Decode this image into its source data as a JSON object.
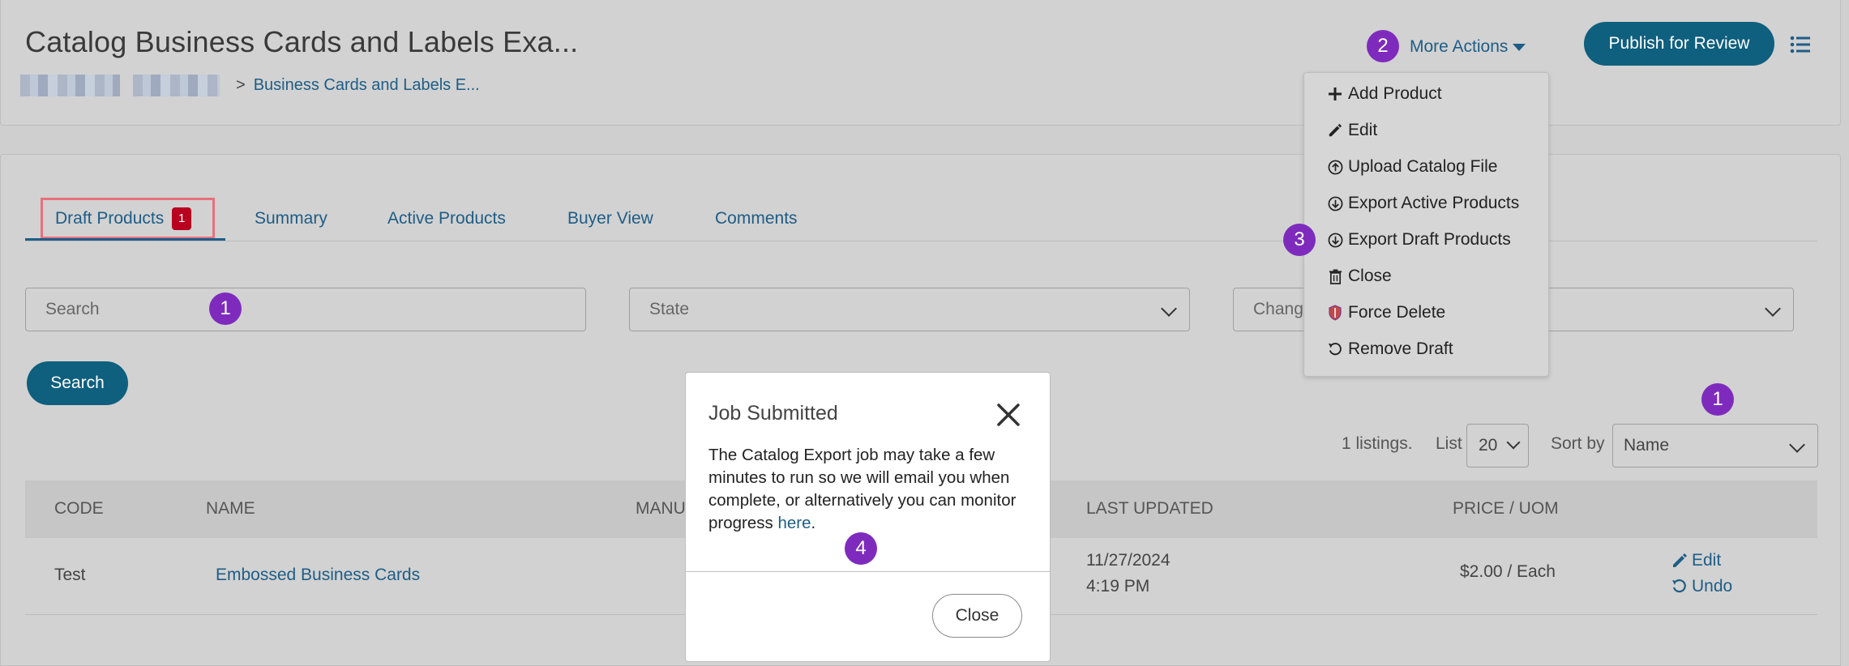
{
  "header": {
    "title": "Catalog Business Cards and Labels Exa...",
    "breadcrumb_sep": ">",
    "breadcrumb_current": "Business Cards and Labels E...",
    "more_actions_label": "More Actions",
    "publish_label": "Publish for Review"
  },
  "more_actions_menu": {
    "items": [
      {
        "label": "Add Product",
        "icon": "plus-icon"
      },
      {
        "label": "Edit",
        "icon": "pencil-icon"
      },
      {
        "label": "Upload Catalog File",
        "icon": "upload-circle-icon"
      },
      {
        "label": "Export Active Products",
        "icon": "download-circle-icon"
      },
      {
        "label": "Export Draft Products",
        "icon": "download-circle-icon"
      },
      {
        "label": "Close",
        "icon": "trash-icon"
      },
      {
        "label": "Force Delete",
        "icon": "shield-icon"
      },
      {
        "label": "Remove Draft",
        "icon": "undo-icon"
      }
    ]
  },
  "tabs": [
    {
      "label": "Draft Products",
      "badge": "1",
      "active": true
    },
    {
      "label": "Summary"
    },
    {
      "label": "Active Products"
    },
    {
      "label": "Buyer View"
    },
    {
      "label": "Comments"
    }
  ],
  "filters": {
    "search_placeholder": "Search",
    "state_placeholder": "State",
    "change_placeholder": "Chang",
    "search_button": "Search"
  },
  "listing_controls": {
    "count_text": "1 listings.",
    "list_label": "List",
    "list_value": "20",
    "sort_label": "Sort by",
    "sort_value": "Name"
  },
  "table": {
    "columns": [
      "CODE",
      "NAME",
      "MANU",
      "LAST UPDATED",
      "PRICE / UOM"
    ],
    "rows": [
      {
        "code": "Test",
        "name": "Embossed Business Cards",
        "last_updated_date": "11/27/2024",
        "last_updated_time": "4:19 PM",
        "price": "$2.00 / Each",
        "edit_label": "Edit",
        "undo_label": "Undo"
      }
    ]
  },
  "modal": {
    "title": "Job Submitted",
    "body_text": "The Catalog Export job may take a few minutes to run so we will email you when complete, or alternatively you can monitor progress ",
    "link_text": "here",
    "body_end": ".",
    "close_label": "Close"
  },
  "step_markers": [
    "1",
    "2",
    "3",
    "1",
    "4"
  ],
  "colors": {
    "accent": "#0f5f7e",
    "link": "#1e5d86",
    "badge": "#b8001f",
    "step_marker": "#7e2bbd",
    "highlight_box": "#e8707e"
  }
}
